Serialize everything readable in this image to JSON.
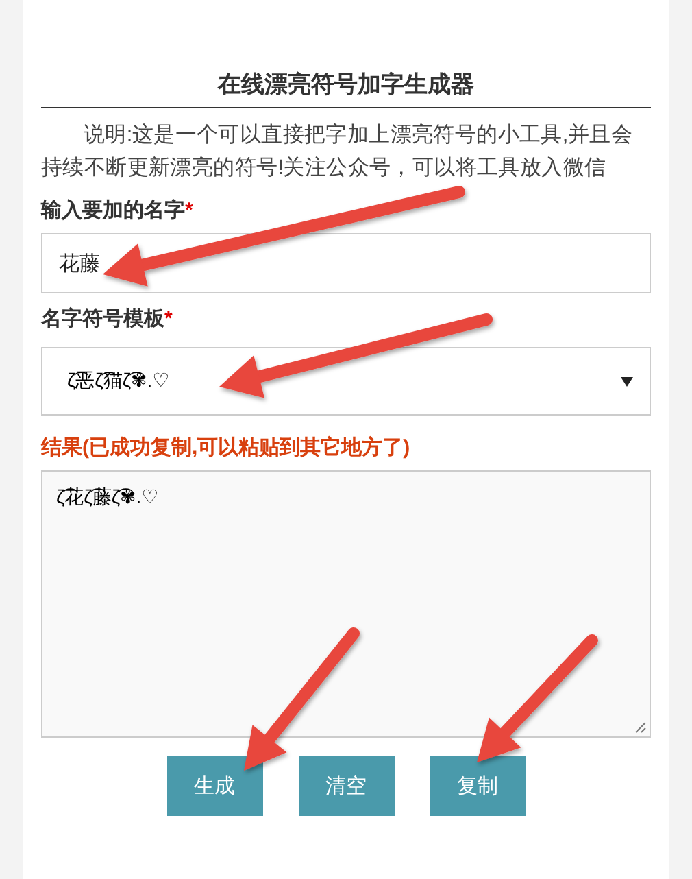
{
  "title": "在线漂亮符号加字生成器",
  "description": "说明:这是一个可以直接把字加上漂亮符号的小工具,并且会持续不断更新漂亮的符号!关注公众号，可以将工具放入微信",
  "name_field": {
    "label": "输入要加的名字",
    "required_mark": "*",
    "value": "花藤"
  },
  "template_select": {
    "label": "名字符号模板",
    "required_mark": "*",
    "value": "ζ͡恶ζ͡猫ζ͡✾.♡"
  },
  "result": {
    "label": "结果(已成功复制,可以粘贴到其它地方了)",
    "value": "ζ͡花ζ͡藤ζ͡✾.♡"
  },
  "buttons": [
    "生成",
    "清空",
    "复制"
  ]
}
